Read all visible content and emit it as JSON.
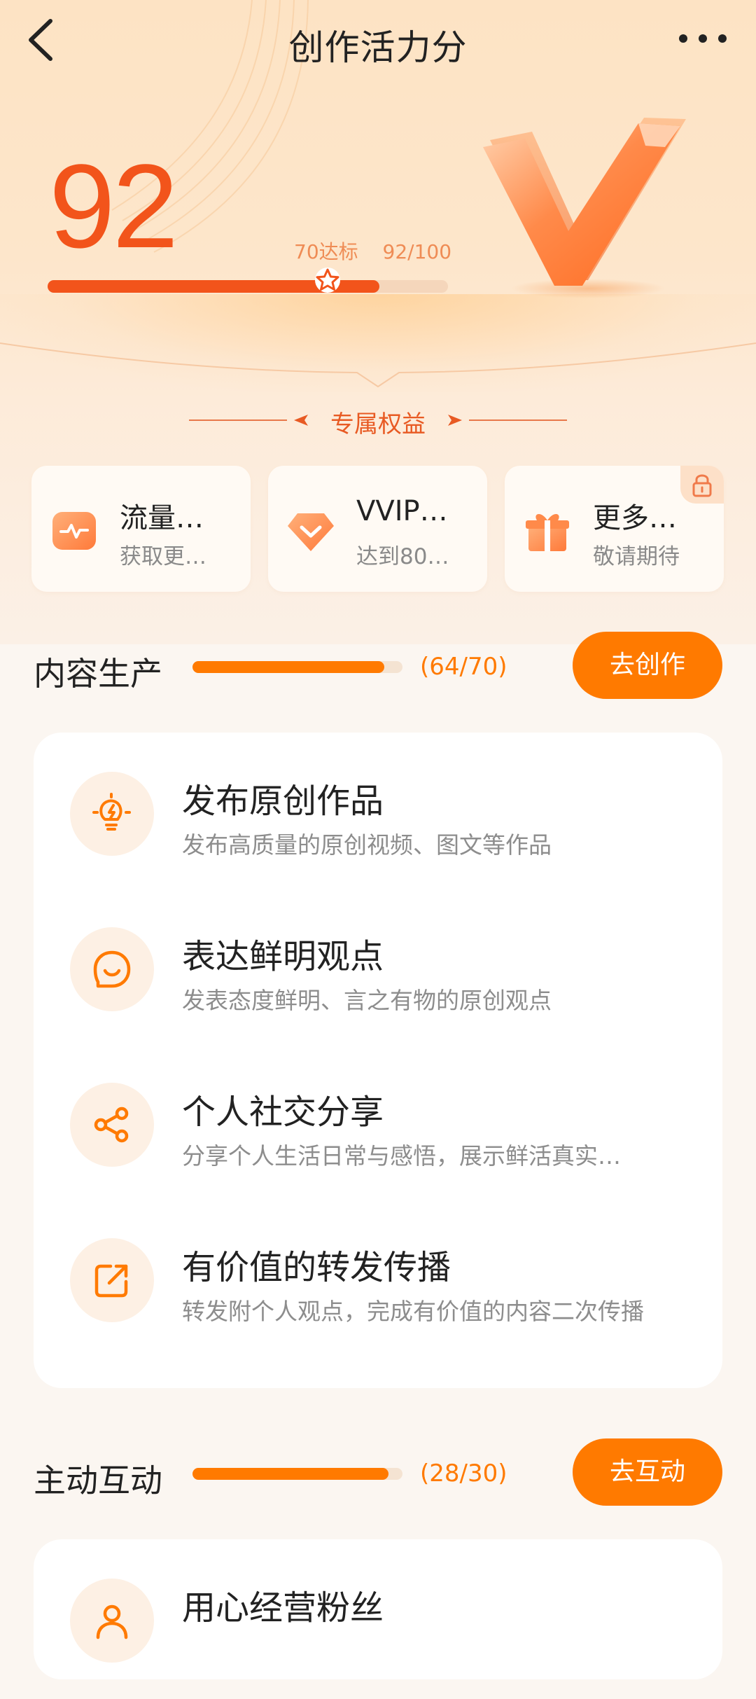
{
  "header": {
    "title": "创作活力分"
  },
  "score": {
    "value": "92",
    "threshold_label": "70达标",
    "progress_text": "92/100",
    "progress": 0.92,
    "threshold": 0.7
  },
  "benefits": {
    "title": "专属权益",
    "cards": [
      {
        "title": "流量…",
        "desc": "获取更…",
        "icon": "traffic-pulse-icon",
        "locked": false
      },
      {
        "title": "VVIP…",
        "desc": "达到80…",
        "icon": "diamond-icon",
        "locked": false
      },
      {
        "title": "更多…",
        "desc": "敬请期待",
        "icon": "gift-icon",
        "locked": true
      }
    ]
  },
  "sections": [
    {
      "name": "内容生产",
      "count": "(64/70)",
      "progress": 0.914,
      "button": "去创作",
      "items": [
        {
          "title": "发布原创作品",
          "desc": "发布高质量的原创视频、图文等作品",
          "icon": "lightbulb-icon"
        },
        {
          "title": "表达鲜明观点",
          "desc": "发表态度鲜明、言之有物的原创观点",
          "icon": "smile-chat-icon"
        },
        {
          "title": "个人社交分享",
          "desc": "分享个人生活日常与感悟，展示鲜活真实…",
          "icon": "share-icon"
        },
        {
          "title": "有价值的转发传播",
          "desc": "转发附个人观点，完成有价值的内容二次传播",
          "icon": "forward-icon"
        }
      ]
    },
    {
      "name": "主动互动",
      "count": "(28/30)",
      "progress": 0.933,
      "button": "去互动",
      "items": [
        {
          "title": "用心经营粉丝",
          "icon": "fans-icon"
        }
      ]
    }
  ],
  "colors": {
    "accent": "#ff7a00",
    "score": "#f2541b",
    "hero_bg": "#fde3c4"
  }
}
